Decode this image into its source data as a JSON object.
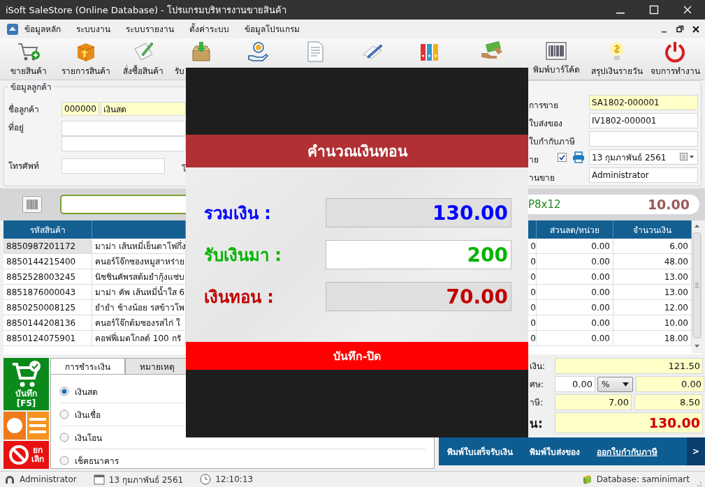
{
  "window": {
    "title": "iSoft SaleStore (Online Database) - โปรแกรมบริหารงานขายสินค้า"
  },
  "menu": [
    "ข้อมูลหลัก",
    "ระบบงาน",
    "ระบบรายงาน",
    "ตั้งค่าระบบ",
    "ข้อมูลโปรแกรม"
  ],
  "toolbar": [
    {
      "kind": "button",
      "label": "ขายสินค้า"
    },
    {
      "kind": "button",
      "label": "รายการสินค้า"
    },
    {
      "kind": "button",
      "label": "สั่งซื้อสินค้า"
    },
    {
      "kind": "cut",
      "label": "รับ"
    },
    {
      "kind": "icon"
    },
    {
      "kind": "icon"
    },
    {
      "kind": "icon"
    },
    {
      "kind": "icon"
    },
    {
      "kind": "icon"
    },
    {
      "kind": "button",
      "label": "พิมพ์บาร์โค้ด"
    },
    {
      "kind": "button",
      "label": "สรุปเงินรายวัน"
    },
    {
      "kind": "button",
      "label": "จบการทำงาน"
    }
  ],
  "customer": {
    "legend": "ข้อมูลลูกค้า",
    "name_label": "ชื่อลูกค้า",
    "code": "000000",
    "name": "เงินสด",
    "address_label": "ที่อยู่",
    "phone_label": "โทรศัพท์",
    "cut_label": "โ"
  },
  "sale_fields": [
    {
      "kind": "text",
      "label": "การขาย",
      "value": "SA1802-000001",
      "highlight": true
    },
    {
      "kind": "text",
      "label": "ใบส่งของ",
      "value": "IV1802-000001",
      "highlight": false
    },
    {
      "kind": "text",
      "label": "ใบกำกับภาษี",
      "highlight": false
    },
    {
      "kind": "date",
      "label": "าย",
      "value": "13  กุมภาพันธ์   2561",
      "highlight": false,
      "print_checked": true
    },
    {
      "kind": "text",
      "label": "านขาย",
      "value": "Administrator",
      "highlight": false
    }
  ],
  "scan": {
    "item": "P8x12",
    "price": "10.00"
  },
  "table": {
    "columns": [
      "รหัสสินค้า",
      "ส่วนลด/หน่วย",
      "จำนวนเงิน"
    ],
    "rows": [
      {
        "code": "8850987201172",
        "name": "มาม่า เส้นหมี่เย็นตาโฟกึ่ง",
        "column_4": "0",
        "discount": "0.00",
        "amount": "6.00",
        "selected": true
      },
      {
        "code": "8850144215400",
        "name": "คนอร์โจ๊กซองหมูสาหร่าย",
        "column_4": "0",
        "discount": "0.00",
        "amount": "48.00",
        "selected": false
      },
      {
        "code": "8852528003245",
        "name": "นิชชินคัพรสต้มยำกุ้งแซ่บ",
        "column_4": "0",
        "discount": "0.00",
        "amount": "13.00",
        "selected": false
      },
      {
        "code": "8851876000043",
        "name": "มาม่า คัพ เส้นหมี่น้ำใส 6",
        "column_4": "0",
        "discount": "0.00",
        "amount": "13.00",
        "selected": false
      },
      {
        "code": "8850250008125",
        "name": "ยำยำ ช้างน้อย รสข้าวโพ",
        "column_4": "0",
        "discount": "0.00",
        "amount": "12.00",
        "selected": false
      },
      {
        "code": "8850144208136",
        "name": "คนอร์โจ๊กต้มซองรสไก่ ใ",
        "column_4": "0",
        "discount": "0.00",
        "amount": "10.00",
        "selected": false
      },
      {
        "code": "8850124075901",
        "name": "คอฟฟี่เมตโกลด์ 100 กรั",
        "column_4": "0",
        "discount": "0.00",
        "amount": "18.00",
        "selected": false
      }
    ]
  },
  "save_button": {
    "label": "บันทึก",
    "shortcut": "[F5]"
  },
  "cancel_button": {
    "lines": [
      "ยก",
      "เลิก"
    ]
  },
  "payment_tabs": [
    {
      "label": "การชำระเงิน",
      "selected": true
    },
    {
      "label": "หมายเหตุ",
      "selected": false
    }
  ],
  "payment_methods": [
    {
      "label": "เงินสด",
      "selected": true
    },
    {
      "label": "เงินเชื่อ",
      "selected": false
    },
    {
      "label": "เงินโอน",
      "selected": false
    },
    {
      "label": "เช็คธนาคาร",
      "selected": false
    }
  ],
  "summary": [
    {
      "kind": "single",
      "label": "เงิน:",
      "value": "121.50"
    },
    {
      "kind": "discount",
      "label": "ศษ:",
      "input": "0.00",
      "unit": "%",
      "value": "0.00"
    },
    {
      "kind": "pair",
      "label": "าษี:",
      "rate": "7.00",
      "value": "8.50"
    },
    {
      "kind": "grand",
      "label": "น:",
      "value": "130.00"
    }
  ],
  "print_actions": [
    {
      "kind": "button",
      "label": "พิมพ์ใบเสร็จรับเงิน"
    },
    {
      "kind": "button",
      "label": "พิมพ์ใบส่งของ"
    },
    {
      "kind": "link",
      "label": "ออกใบกำกับภาษี"
    }
  ],
  "more_button": ">",
  "status_bar": {
    "user": "Administrator",
    "date": "13 กุมภาพันธ์ 2561",
    "time": "12:10:13",
    "database": "Database: saminimart"
  },
  "dialog": {
    "title": "คำนวณเงินทอน",
    "rows": [
      {
        "label": "รวมเงิน :",
        "value": "130.00",
        "color": "#0000ff",
        "editable": false
      },
      {
        "label": "รับเงินมา :",
        "value": "200",
        "color": "#00b400",
        "editable": true
      },
      {
        "label": "เงินทอน :",
        "value": "70.00",
        "color": "#c00000",
        "editable": false
      }
    ],
    "button": "บันทึก-ปิด"
  }
}
